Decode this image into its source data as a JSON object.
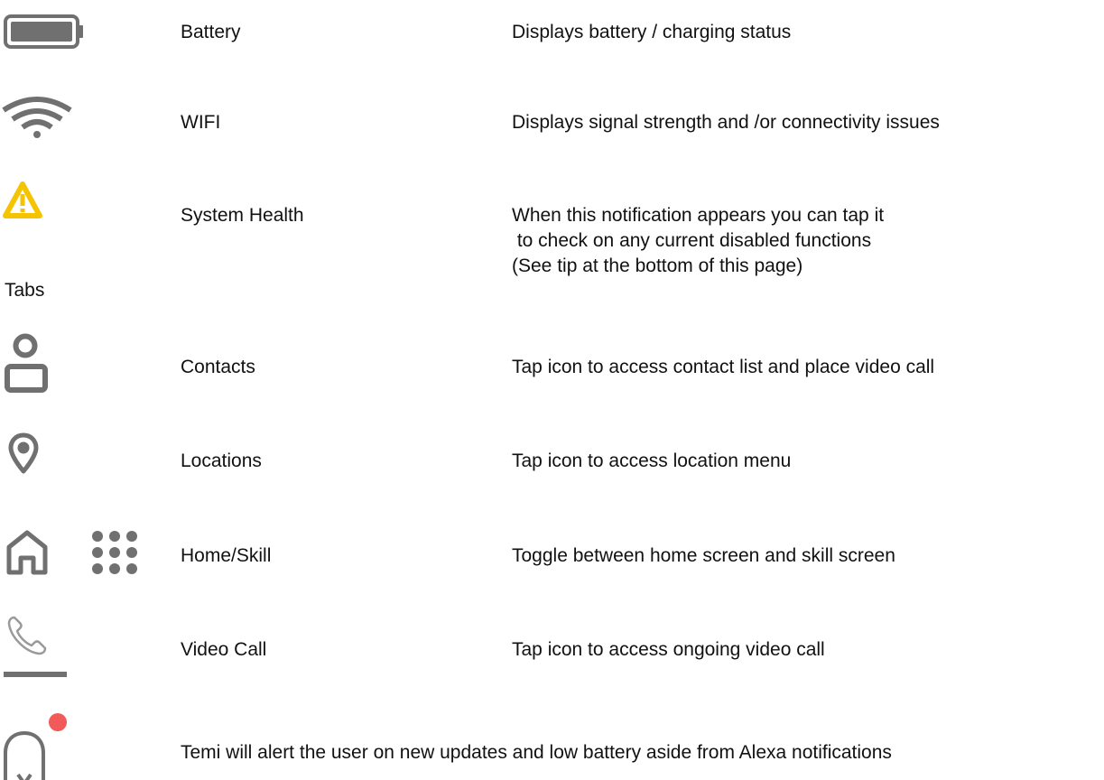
{
  "section_label": "Tabs",
  "status_icons": [
    {
      "icon": "battery-icon",
      "label": "Battery",
      "description": "Displays battery / charging status"
    },
    {
      "icon": "wifi-icon",
      "label": "WIFI",
      "description": "Displays signal strength and /or connectivity issues"
    },
    {
      "icon": "warning-icon",
      "label": "System Health",
      "description_lines": [
        "When this notification appears you can tap it",
        " to check on any current disabled functions",
        "(See tip at the bottom of this page)"
      ]
    }
  ],
  "tab_icons": [
    {
      "icon": "contacts-icon",
      "label": "Contacts",
      "description": "Tap icon to access contact list and place video call"
    },
    {
      "icon": "location-pin-icon",
      "label": "Locations",
      "description": "Tap icon to access location menu"
    },
    {
      "icon": "home-icon",
      "icon_secondary": "skills-grid-icon",
      "label": "Home/Skill",
      "description": "Toggle between home screen and skill screen"
    },
    {
      "icon": "phone-icon",
      "label": "Video Call",
      "description": "Tap icon to access ongoing video call"
    }
  ],
  "notifications": {
    "icon": "bell-icon",
    "text": "Temi will alert the user on new updates and low battery aside from Alexa notifications"
  },
  "colors": {
    "icon_gray": "#707070",
    "warning_yellow": "#F5C400",
    "notification_dot": "#F25A5A",
    "text": "#111111"
  }
}
